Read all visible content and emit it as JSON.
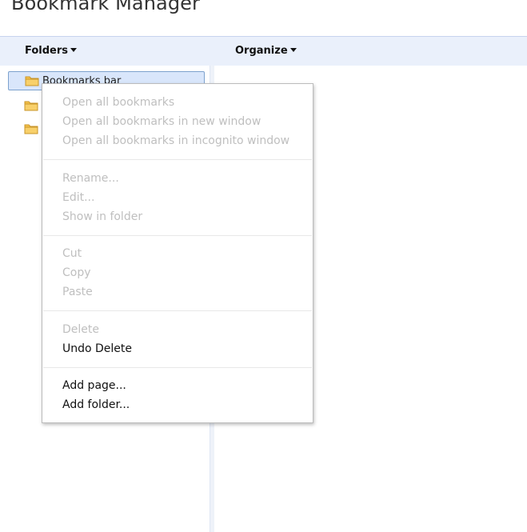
{
  "page": {
    "title": "Bookmark Manager"
  },
  "toolbar": {
    "folders_label": "Folders",
    "organize_label": "Organize"
  },
  "tree": {
    "items": [
      {
        "label": "Bookmarks bar",
        "selected": true
      },
      {
        "label": "",
        "selected": false
      },
      {
        "label": "",
        "selected": false
      }
    ]
  },
  "context_menu": {
    "groups": [
      [
        {
          "label": "Open all bookmarks",
          "enabled": false
        },
        {
          "label": "Open all bookmarks in new window",
          "enabled": false
        },
        {
          "label": "Open all bookmarks in incognito window",
          "enabled": false
        }
      ],
      [
        {
          "label": "Rename...",
          "enabled": false
        },
        {
          "label": "Edit...",
          "enabled": false
        },
        {
          "label": "Show in folder",
          "enabled": false
        }
      ],
      [
        {
          "label": "Cut",
          "enabled": false
        },
        {
          "label": "Copy",
          "enabled": false
        },
        {
          "label": "Paste",
          "enabled": false
        }
      ],
      [
        {
          "label": "Delete",
          "enabled": false
        },
        {
          "label": "Undo Delete",
          "enabled": true
        }
      ],
      [
        {
          "label": "Add page...",
          "enabled": true
        },
        {
          "label": "Add folder...",
          "enabled": true
        }
      ]
    ]
  },
  "colors": {
    "toolbar_bg": "#eaf0fb",
    "selection_bg": "#d9e6fb",
    "disabled_text": "#bfbfbf",
    "folder_fill": "#f5c24a"
  }
}
